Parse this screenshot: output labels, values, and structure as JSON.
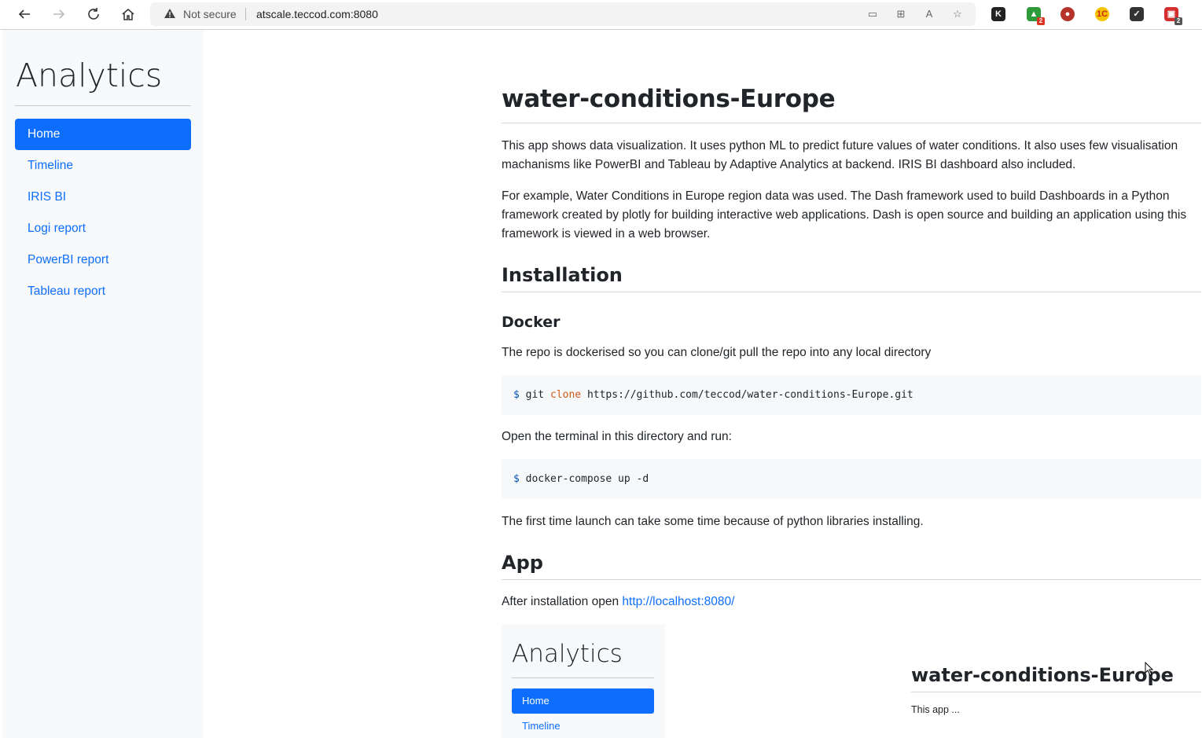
{
  "browser": {
    "security_label": "Not secure",
    "url": "atscale.teccod.com:8080",
    "extension_badges": [
      "2",
      "2"
    ]
  },
  "sidebar": {
    "brand": "Analytics",
    "items": [
      {
        "label": "Home",
        "active": true
      },
      {
        "label": "Timeline"
      },
      {
        "label": "IRIS BI"
      },
      {
        "label": "Logi report"
      },
      {
        "label": "PowerBI report"
      },
      {
        "label": "Tableau report"
      }
    ]
  },
  "main": {
    "title": "water-conditions-Europe",
    "intro1": "This app shows data visualization. It uses python ML to predict future values of water conditions. It also uses few visualisation machanisms like PowerBI and Tableau by Adaptive Analytics at backend. IRIS BI dashboard also included.",
    "intro2": "For example, Water Conditions in Europe region data was used. The Dash framework used to build Dashboards in a Python framework created by plotly for building interactive web applications. Dash is open source and building an application using this framework is viewed in a web browser.",
    "installation_heading": "Installation",
    "docker_heading": "Docker",
    "docker_text": "The repo is dockerised so you can clone/git pull the repo into any local directory",
    "code1": {
      "prompt": "$",
      "cmd": "git",
      "keyword": "clone",
      "arg": "https://github.com/teccod/water-conditions-Europe.git"
    },
    "terminal_text": "Open the terminal in this directory and run:",
    "code2": {
      "prompt": "$",
      "cmd": "docker-compose up -d"
    },
    "launch_text": "The first time launch can take some time because of python libraries installing.",
    "app_heading": "App",
    "after_install_text": "After installation open",
    "localhost_link": "http://localhost:8080/",
    "preview": {
      "brand": "Analytics",
      "home": "Home",
      "timeline": "Timeline",
      "title": "water-conditions-Europe",
      "app_text": "This app ..."
    }
  }
}
